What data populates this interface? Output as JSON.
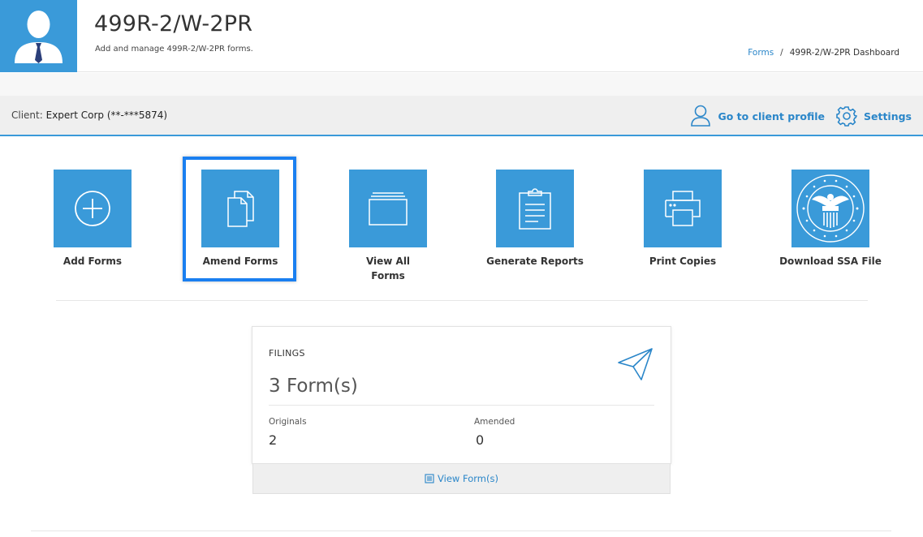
{
  "header": {
    "title": "499R-2/W-2PR",
    "subtitle": "Add and manage 499R-2/W-2PR forms.",
    "breadcrumb": {
      "link": "Forms",
      "separator": "/",
      "current": "499R-2/W-2PR Dashboard"
    }
  },
  "client_bar": {
    "label": "Client:",
    "client_name": "Expert Corp (**-***5874)",
    "profile_link": "Go to client profile",
    "settings_link": "Settings"
  },
  "tiles": [
    {
      "label": "Add Forms",
      "icon": "plus-circle-icon"
    },
    {
      "label": "Amend Forms",
      "icon": "documents-icon"
    },
    {
      "label": "View All Forms",
      "icon": "folder-stack-icon"
    },
    {
      "label": "Generate Reports",
      "icon": "clipboard-icon"
    },
    {
      "label": "Print Copies",
      "icon": "printer-icon"
    },
    {
      "label": "Download SSA File",
      "icon": "ssa-seal-icon"
    }
  ],
  "filings": {
    "title": "FILINGS",
    "count": "3 Form(s)",
    "originals_label": "Originals",
    "originals_value": "2",
    "amended_label": "Amended",
    "amended_value": "0",
    "view_link": "View Form(s)"
  },
  "colors": {
    "accent": "#3a9ad9",
    "link": "#2a86c9",
    "highlight": "#1a7ff0"
  }
}
